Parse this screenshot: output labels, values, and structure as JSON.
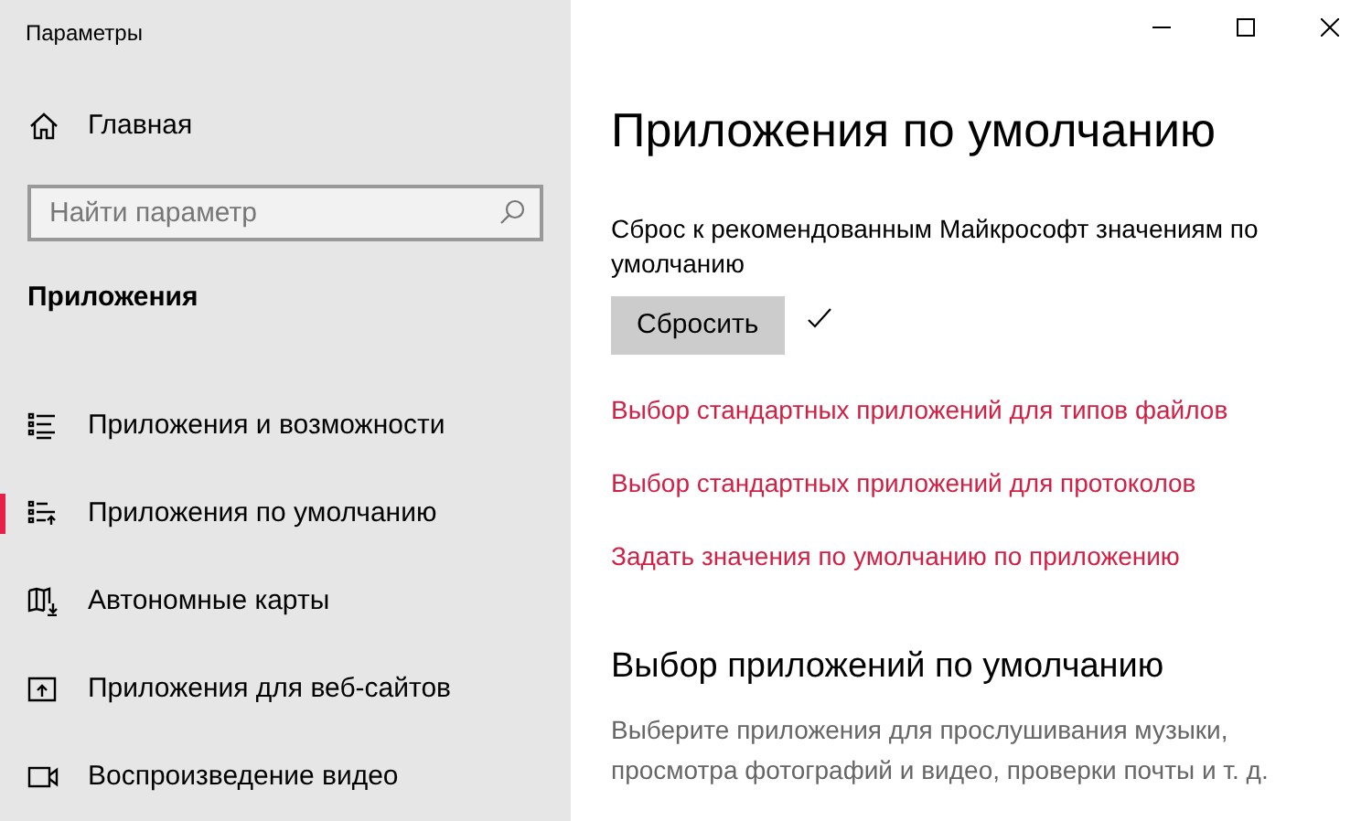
{
  "window": {
    "title": "Параметры"
  },
  "sidebar": {
    "home": "Главная",
    "search": {
      "placeholder": "Найти параметр"
    },
    "section": "Приложения",
    "items": [
      {
        "label": "Приложения и возможности",
        "kind": "list",
        "selected": false
      },
      {
        "label": "Приложения по умолчанию",
        "kind": "defaults",
        "selected": true
      },
      {
        "label": "Автономные карты",
        "kind": "map",
        "selected": false
      },
      {
        "label": "Приложения для веб-сайтов",
        "kind": "web",
        "selected": false
      },
      {
        "label": "Воспроизведение видео",
        "kind": "video",
        "selected": false
      }
    ]
  },
  "main": {
    "title": "Приложения по умолчанию",
    "reset_text": "Сброс к рекомендованным Майкрософт значениям по умолчанию",
    "reset_button": "Сбросить",
    "reset_done": true,
    "links": [
      "Выбор стандартных приложений для типов файлов",
      "Выбор стандартных приложений для протоколов",
      "Задать значения по умолчанию по приложению"
    ],
    "subtitle": "Выбор приложений по умолчанию",
    "description": "Выберите приложения для прослушивания музыки, просмотра фотографий и видео, проверки почты и т. д."
  }
}
